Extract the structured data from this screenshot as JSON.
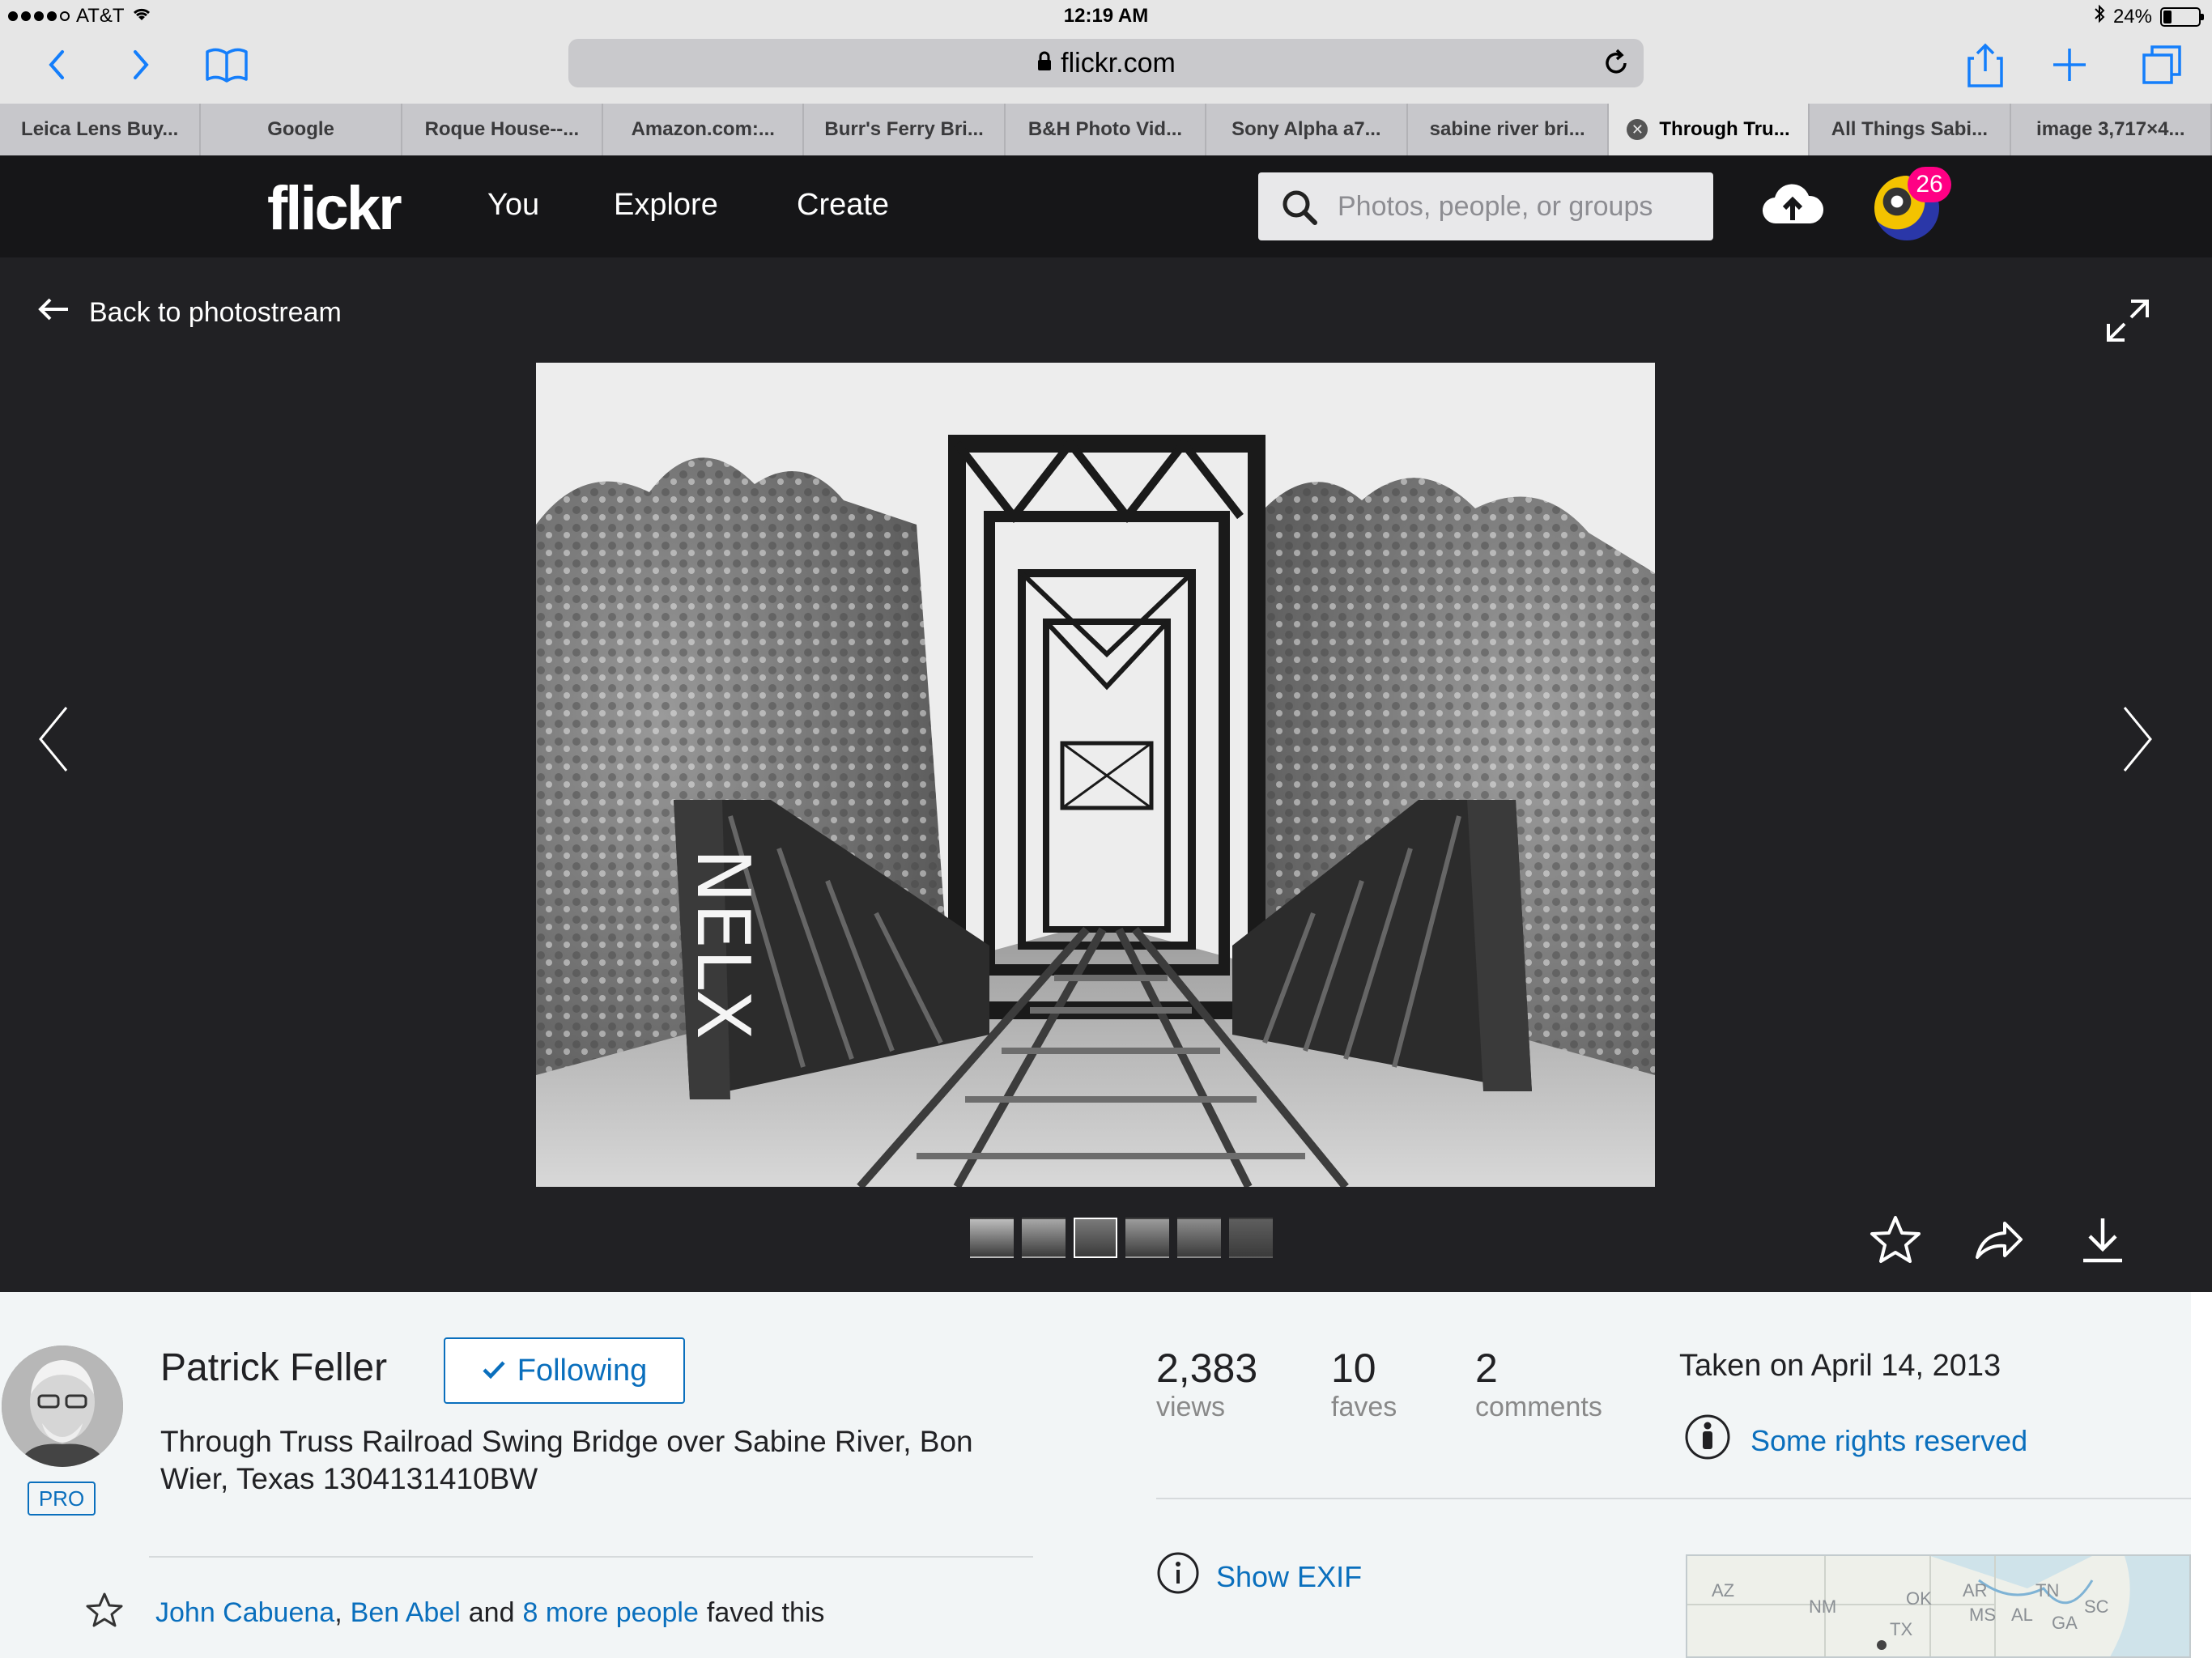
{
  "status_bar": {
    "carrier": "AT&T",
    "time": "12:19 AM",
    "battery": "24%",
    "battery_level": 0.24
  },
  "safari": {
    "url": "flickr.com",
    "tabs": [
      {
        "label": "Leica Lens Buy...",
        "active": false
      },
      {
        "label": "Google",
        "active": false
      },
      {
        "label": "Roque House--...",
        "active": false
      },
      {
        "label": "Amazon.com:...",
        "active": false
      },
      {
        "label": "Burr's Ferry Bri...",
        "active": false
      },
      {
        "label": "B&H Photo Vid...",
        "active": false
      },
      {
        "label": "Sony Alpha a7...",
        "active": false
      },
      {
        "label": "sabine river bri...",
        "active": false
      },
      {
        "label": "Through Tru...",
        "active": true
      },
      {
        "label": "All Things Sabi...",
        "active": false
      },
      {
        "label": "image 3,717×4...",
        "active": false
      }
    ]
  },
  "flickr_header": {
    "logo": "flickr",
    "nav": {
      "you": "You",
      "explore": "Explore",
      "create": "Create"
    },
    "search_placeholder": "Photos, people, or groups",
    "notification_count": "26"
  },
  "viewer": {
    "back_label": "Back to photostream",
    "thumbnail_count": 6,
    "current_thumbnail": 3
  },
  "photo_info": {
    "author": "Patrick Feller",
    "pro_badge": "PRO",
    "follow_label": "Following",
    "title": "Through Truss Railroad Swing Bridge over Sabine River, Bon Wier, Texas 1304131410BW",
    "faved_by": [
      "John Cabuena",
      "Ben Abel"
    ],
    "faved_separator": ",",
    "faved_and": "and",
    "faved_more": "8 more people",
    "faved_suffix": "faved this",
    "stats": {
      "views": {
        "value": "2,383",
        "label": "views"
      },
      "faves": {
        "value": "10",
        "label": "faves"
      },
      "comments": {
        "value": "2",
        "label": "comments"
      }
    },
    "taken_on": "Taken on April 14, 2013",
    "license": "Some rights reserved",
    "exif_label": "Show EXIF",
    "map_labels": [
      "AZ",
      "NM",
      "OK",
      "AR",
      "TN",
      "MS",
      "AL",
      "SC",
      "GA",
      "TX"
    ]
  },
  "colors": {
    "flickr_header_bg": "#161618",
    "stage_bg": "#212124",
    "link_blue": "#0a6fbd",
    "notification_pink": "#ff0084",
    "safari_blue": "#147efb"
  }
}
